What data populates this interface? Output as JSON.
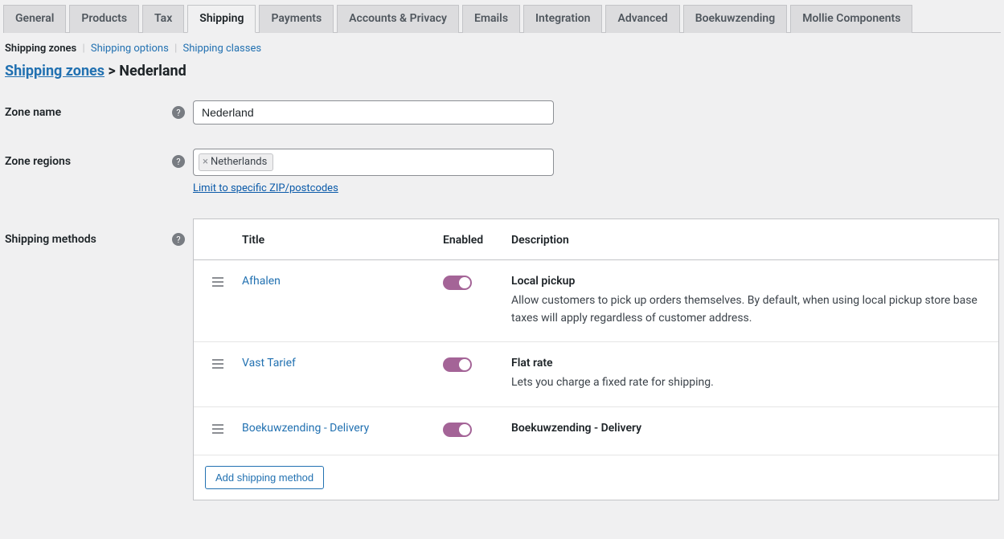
{
  "tabs": {
    "general": "General",
    "products": "Products",
    "tax": "Tax",
    "shipping": "Shipping",
    "payments": "Payments",
    "accounts_privacy": "Accounts & Privacy",
    "emails": "Emails",
    "integration": "Integration",
    "advanced": "Advanced",
    "boekuwzending": "Boekuwzending",
    "mollie_components": "Mollie Components"
  },
  "subtabs": {
    "zones": "Shipping zones",
    "options": "Shipping options",
    "classes": "Shipping classes"
  },
  "breadcrumb": {
    "parent": "Shipping zones",
    "sep": " > ",
    "current": "Nederland"
  },
  "form": {
    "zone_name_label": "Zone name",
    "zone_name_value": "Nederland",
    "zone_regions_label": "Zone regions",
    "zone_region_tag": "Netherlands",
    "zip_link": "Limit to specific ZIP/postcodes",
    "shipping_methods_label": "Shipping methods",
    "help_tip_glyph": "?"
  },
  "table": {
    "header_title": "Title",
    "header_enabled": "Enabled",
    "header_description": "Description",
    "add_method": "Add shipping method",
    "rows": [
      {
        "title": "Afhalen",
        "enabled": true,
        "desc_title": "Local pickup",
        "desc_text": "Allow customers to pick up orders themselves. By default, when using local pickup store base taxes will apply regardless of customer address."
      },
      {
        "title": "Vast Tarief",
        "enabled": true,
        "desc_title": "Flat rate",
        "desc_text": "Lets you charge a fixed rate for shipping."
      },
      {
        "title": "Boekuwzending - Delivery",
        "enabled": true,
        "desc_title": "Boekuwzending - Delivery",
        "desc_text": ""
      }
    ]
  }
}
